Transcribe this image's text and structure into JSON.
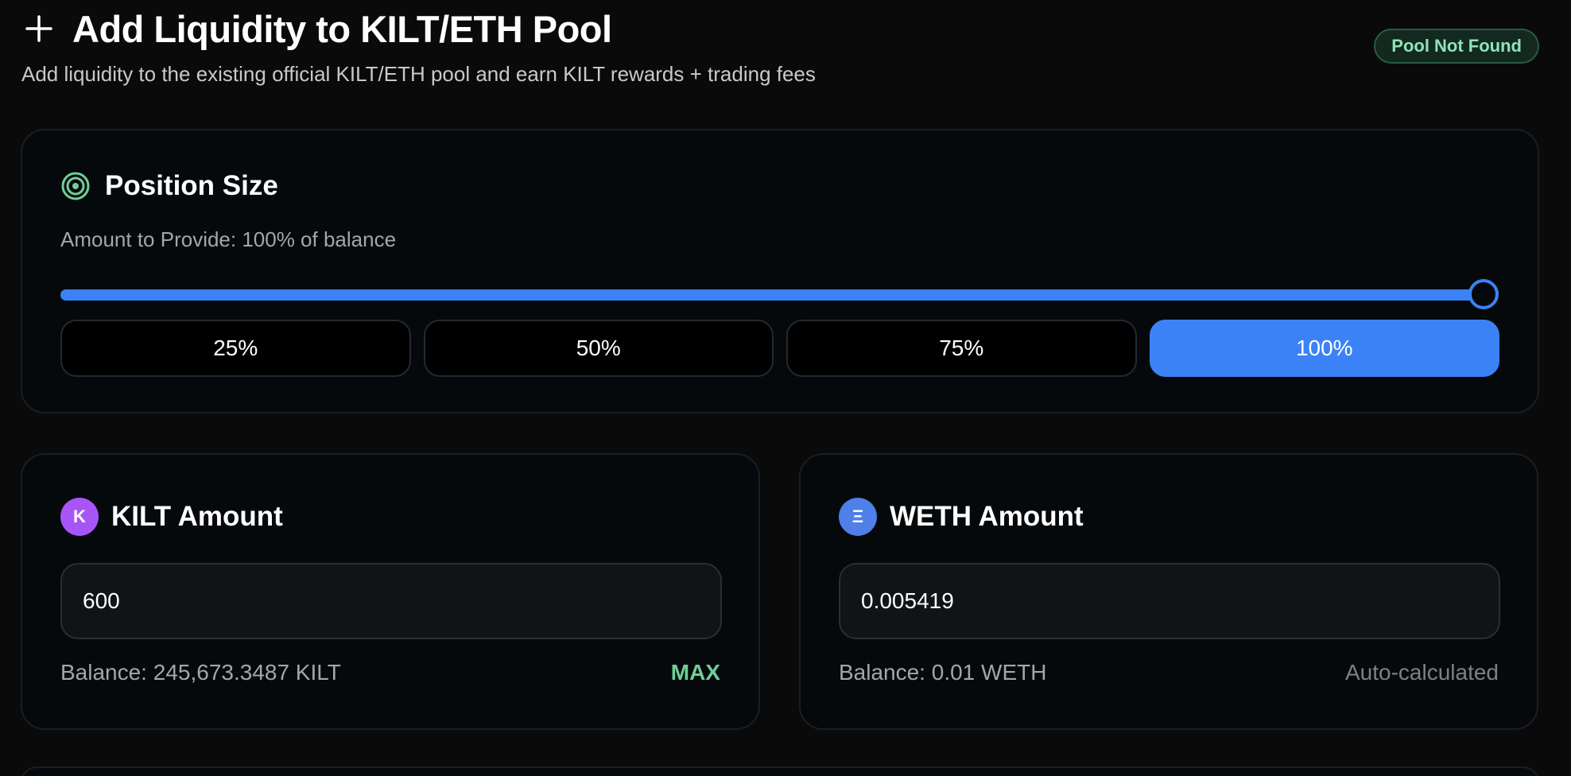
{
  "header": {
    "title": "Add Liquidity to KILT/ETH Pool",
    "subtitle": "Add liquidity to the existing official KILT/ETH pool and earn KILT rewards + trading fees",
    "status_badge": "Pool Not Found"
  },
  "position_size": {
    "title": "Position Size",
    "amount_label": "Amount to Provide: 100% of balance",
    "slider_value_percent": 100,
    "buttons": [
      {
        "label": "25%",
        "active": false
      },
      {
        "label": "50%",
        "active": false
      },
      {
        "label": "75%",
        "active": false
      },
      {
        "label": "100%",
        "active": true
      }
    ]
  },
  "kilt": {
    "icon_letter": "K",
    "icon_color": "#a855f7",
    "title": "KILT Amount",
    "value": "600",
    "balance": "Balance: 245,673.3487 KILT",
    "max_label": "MAX"
  },
  "weth": {
    "icon_letter": "Ξ",
    "icon_color": "#4f7fe8",
    "title": "WETH Amount",
    "value": "0.005419",
    "balance": "Balance: 0.01 WETH",
    "note": "Auto-calculated"
  },
  "colors": {
    "accent": "#3b82f6",
    "success": "#6fcf97",
    "background": "#0a0a0b"
  }
}
